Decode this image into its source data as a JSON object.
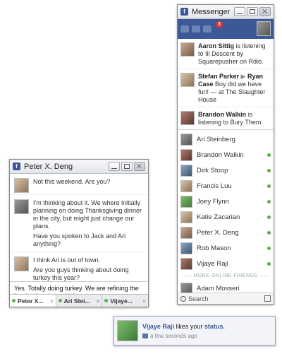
{
  "messenger": {
    "title": "Messenger",
    "badge_count": "3",
    "ticker": [
      {
        "name": "Aaron Sittig",
        "text": "is listening to Ill Descent by Squarepusher on Rdio."
      },
      {
        "name": "Stefan Parker",
        "arrow": "▶",
        "target": "Ryan Case",
        "text": "Boy did we have fun! — at The Slaughter House"
      },
      {
        "name": "Brandon Walkin",
        "text": "is listening to Bury Them"
      }
    ],
    "contacts": [
      {
        "name": "Ari Steinberg",
        "online": false
      },
      {
        "name": "Brandon Walkin",
        "online": true
      },
      {
        "name": "Dirk Stoop",
        "online": true
      },
      {
        "name": "Francis Luu",
        "online": true
      },
      {
        "name": "Joey Flynn",
        "online": true
      },
      {
        "name": "Katie Zacarian",
        "online": true
      },
      {
        "name": "Peter X. Deng",
        "online": true
      },
      {
        "name": "Rob Mason",
        "online": true
      },
      {
        "name": "Vijaye Raji",
        "online": true
      }
    ],
    "more_online_label": "MORE ONLINE FRIENDS",
    "more_contacts": [
      {
        "name": "Adam Mosseri",
        "online": true
      }
    ],
    "search_label": "Search"
  },
  "chat": {
    "title": "Peter X. Deng",
    "messages": [
      {
        "lines": [
          "Not this weekend. Are you?"
        ]
      },
      {
        "lines": [
          "I'm thinking about it. We where initially planning on doing Thanksgiving dinner in the city, but might just change our plans.",
          "Have you spoken to Jack and Ari anything?"
        ]
      },
      {
        "lines": [
          "I think Ari is out of town.",
          "Are you guys thinking about doing turkey this year?"
        ]
      }
    ],
    "compose_text": "Yes. Totally doing turkey. We are refining the \"perfect\" recipie which",
    "tabs": [
      {
        "label": "Peter X..."
      },
      {
        "label": "Ari Stei..."
      },
      {
        "label": "Vijaye..."
      }
    ],
    "tab_close_glyph": "×"
  },
  "notification": {
    "name": "Vijaye Raji",
    "middle": "likes your",
    "object": "status.",
    "time": "a few seconds ago"
  },
  "colors": {
    "brand": "#3b5998",
    "online": "#59b147",
    "badge": "#e02f2f"
  }
}
